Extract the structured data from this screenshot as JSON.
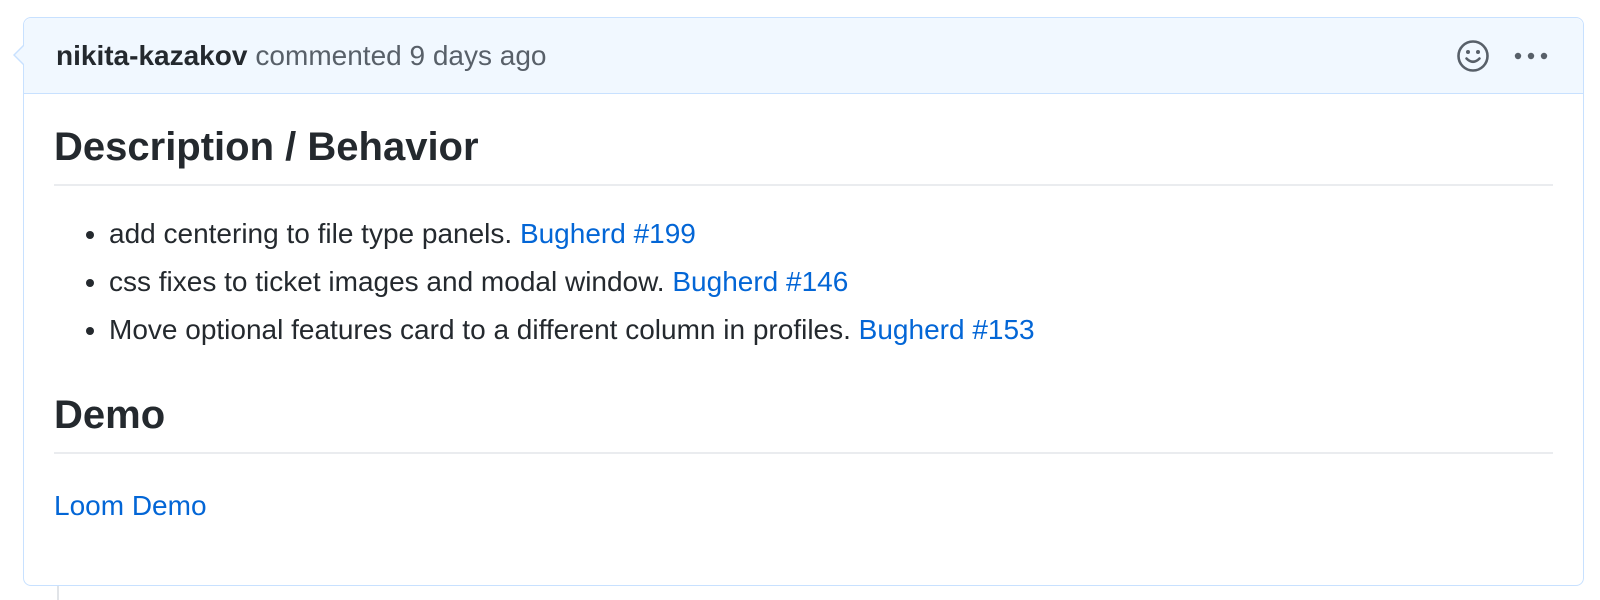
{
  "comment": {
    "author": "nikita-kazakov",
    "action": "commented",
    "time": "9 days ago",
    "icons": {
      "reaction": "smiley-icon",
      "more": "kebab-horizontal-icon"
    },
    "sections": [
      {
        "heading": "Description / Behavior",
        "items": [
          {
            "text": "add centering to file type panels.",
            "link": "Bugherd #199"
          },
          {
            "text": "css fixes to ticket images and modal window.",
            "link": "Bugherd #146"
          },
          {
            "text": "Move optional features card to a different column in profiles.",
            "link": "Bugherd #153"
          }
        ]
      },
      {
        "heading": "Demo",
        "link": "Loom Demo"
      }
    ]
  },
  "colors": {
    "header_bg": "#f1f8ff",
    "border": "#c8e1ff",
    "link": "#0366d6",
    "text": "#24292e",
    "muted": "#586069"
  }
}
